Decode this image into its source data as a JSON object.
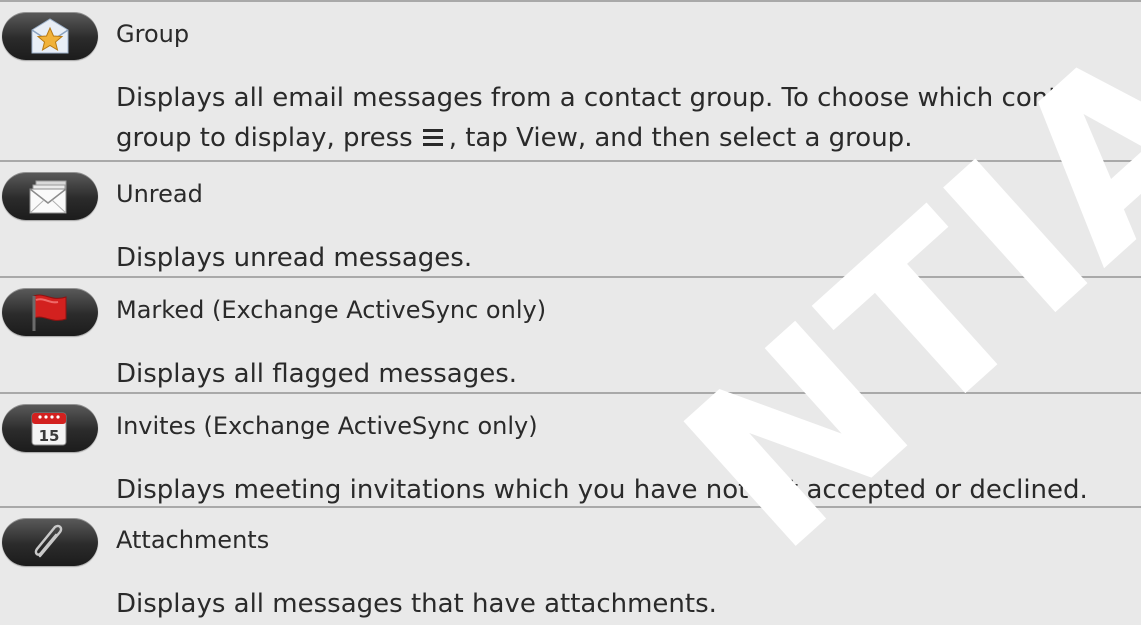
{
  "rows": [
    {
      "title": "Group",
      "note": "",
      "icon": "group-star-envelope-icon",
      "desc_part1": "Displays all email messages from a contact group. To choose which contact group to display, press",
      "desc_part2": ", tap",
      "desc_view": "View",
      "desc_part3": ", and then select a group."
    },
    {
      "title": "Unread",
      "note": "",
      "icon": "unread-envelopes-icon",
      "desc": "Displays unread messages."
    },
    {
      "title": "Marked",
      "note": " (Exchange ActiveSync only)",
      "icon": "red-flag-icon",
      "desc": "Displays all flagged messages."
    },
    {
      "title": "Invites",
      "note": " (Exchange ActiveSync only)",
      "icon": "calendar-icon",
      "calendar_day": "15",
      "desc": "Displays meeting invitations which you have not yet accepted or declined."
    },
    {
      "title": "Attachments",
      "note": "",
      "icon": "paperclip-icon",
      "desc": "Displays all messages that have attachments."
    }
  ],
  "menu_icon": "menu-icon",
  "watermark_text": "NTIA",
  "colors": {
    "background": "#e9e9e9",
    "divider": "#a9a9a9",
    "text": "#2a2a2a"
  }
}
